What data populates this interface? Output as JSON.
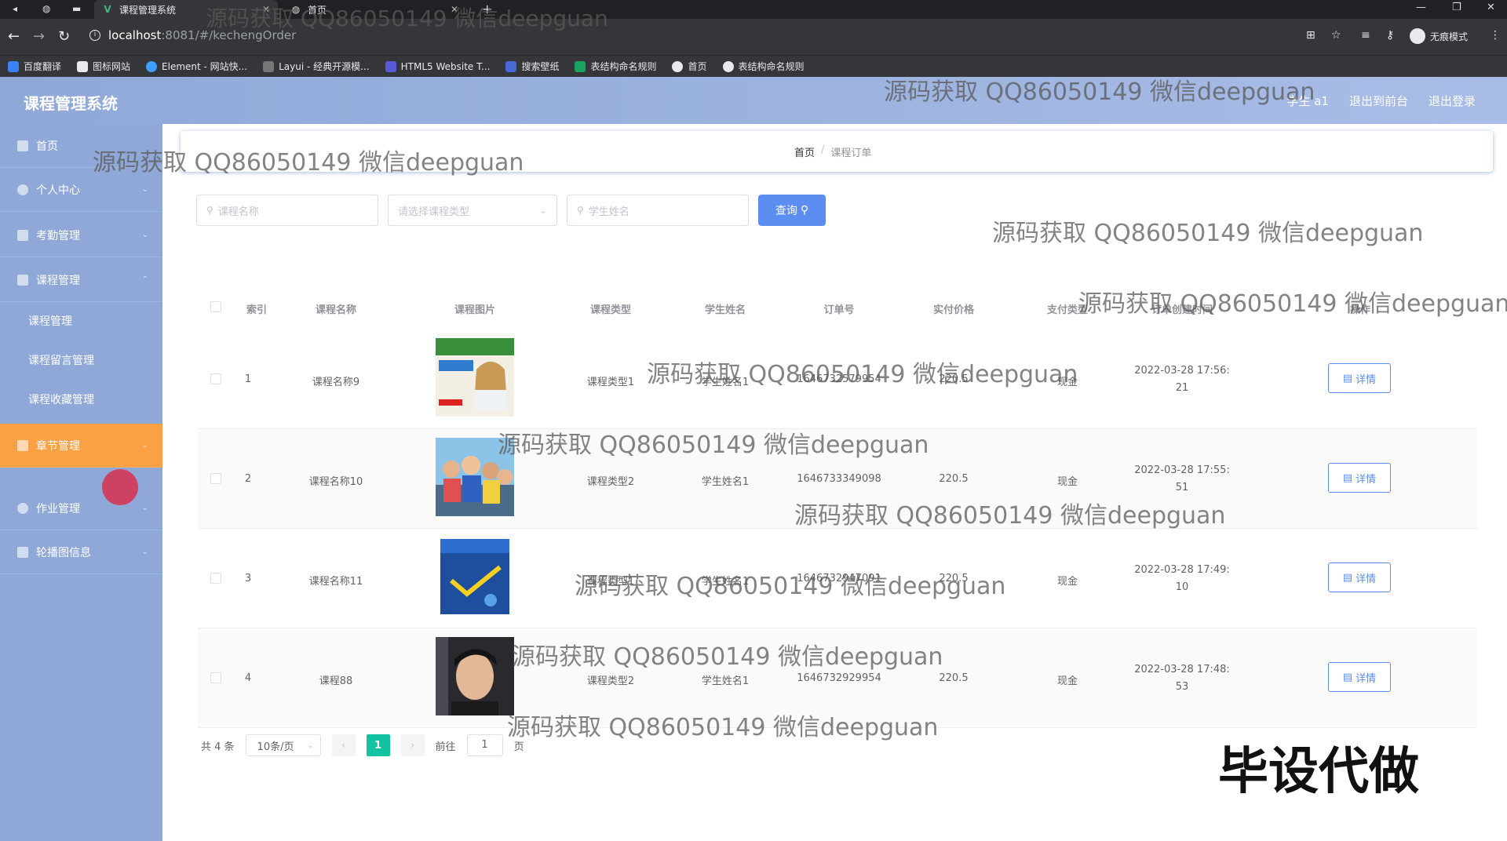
{
  "browser": {
    "tabs": [
      {
        "title": "课程管理系统",
        "active": true
      },
      {
        "title": "首页",
        "active": false
      }
    ],
    "url_host": "localhost",
    "url_path": ":8081/#/kechengOrder",
    "incognito_label": "无痕模式",
    "bookmarks": [
      "百度翻译",
      "图标网站",
      "Element - 网站快...",
      "Layui - 经典开源模...",
      "HTML5 Website T...",
      "搜索壁纸",
      "表结构命名规则",
      "首页",
      "表结构命名规则"
    ]
  },
  "header": {
    "title": "课程管理系统",
    "user": "学生 a1",
    "back_front": "退出到前台",
    "logout": "退出登录"
  },
  "sidebar": {
    "items": [
      {
        "label": "首页"
      },
      {
        "label": "个人中心"
      },
      {
        "label": "考勤管理"
      },
      {
        "label": "课程管理"
      }
    ],
    "sub_items": [
      {
        "label": "课程管理"
      },
      {
        "label": "课程留言管理"
      },
      {
        "label": "课程收藏管理"
      }
    ],
    "active_item": {
      "label": "章节管理"
    },
    "tail_items": [
      {
        "label": "作业管理"
      },
      {
        "label": "轮播图信息"
      }
    ],
    "active_color": "#fca045"
  },
  "breadcrumb": {
    "home": "首页",
    "current": "课程订单"
  },
  "search": {
    "course_name_placeholder": "课程名称",
    "course_type_placeholder": "请选择课程类型",
    "student_name_placeholder": "学生姓名",
    "query_label": "查询"
  },
  "table": {
    "columns": [
      "索引",
      "课程名称",
      "课程图片",
      "课程类型",
      "学生姓名",
      "订单号",
      "实付价格",
      "支付类型",
      "订单创建时间",
      "操作"
    ],
    "rows": [
      {
        "index": "1",
        "name": "课程名称9",
        "type": "课程类型1",
        "student": "学生姓名1",
        "order_no": "1646732579954",
        "price": "220.5",
        "pay": "现金",
        "time_1": "2022-03-28 17:56:",
        "time_2": "21",
        "action": "详情"
      },
      {
        "index": "2",
        "name": "课程名称10",
        "type": "课程类型2",
        "student": "学生姓名1",
        "order_no": "1646733349098",
        "price": "220.5",
        "pay": "现金",
        "time_1": "2022-03-28 17:55:",
        "time_2": "51",
        "action": "详情"
      },
      {
        "index": "3",
        "name": "课程名称11",
        "type": "课程类型1",
        "student": "学生姓名1",
        "order_no": "1646732947091",
        "price": "220.5",
        "pay": "现金",
        "time_1": "2022-03-28 17:49:",
        "time_2": "10",
        "action": "详情"
      },
      {
        "index": "4",
        "name": "课程88",
        "type": "课程类型2",
        "student": "学生姓名1",
        "order_no": "1646732929954",
        "price": "220.5",
        "pay": "现金",
        "time_1": "2022-03-28 17:48:",
        "time_2": "53",
        "action": "详情"
      }
    ]
  },
  "pagination": {
    "total": "共 4 条",
    "page_size": "10条/页",
    "current_page": "1",
    "goto_label": "前往",
    "goto_value": "1",
    "page_suffix": "页"
  },
  "watermark": {
    "text": "源码获取 QQ86050149 微信deepguan",
    "big": "毕设代做"
  },
  "colors": {
    "header": "#8fa8d8",
    "primary": "#5b8ef0",
    "pager_active": "#13c2a0"
  }
}
